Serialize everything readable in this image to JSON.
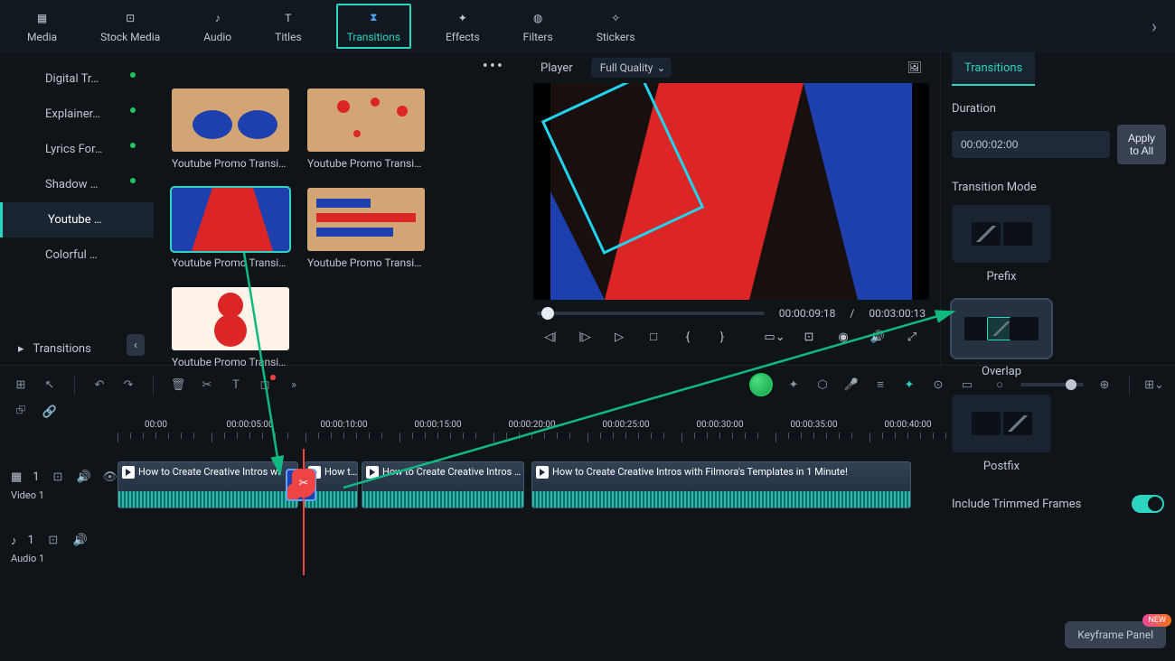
{
  "topTabs": {
    "media": "Media",
    "stockMedia": "Stock Media",
    "audio": "Audio",
    "titles": "Titles",
    "transitions": "Transitions",
    "effects": "Effects",
    "filters": "Filters",
    "stickers": "Stickers"
  },
  "sidebar": {
    "items": [
      {
        "label": "Digital Tr…"
      },
      {
        "label": "Explainer…"
      },
      {
        "label": "Lyrics For…"
      },
      {
        "label": "Shadow …"
      },
      {
        "label": "Youtube …"
      },
      {
        "label": "Colorful …"
      }
    ],
    "bottomGroup": "Transitions"
  },
  "library": {
    "items": [
      {
        "label": "Youtube Promo Transi…"
      },
      {
        "label": "Youtube Promo Transi…"
      },
      {
        "label": "Youtube Promo Transi…"
      },
      {
        "label": "Youtube Promo Transi…"
      },
      {
        "label": "Youtube Promo Transi…"
      }
    ],
    "selectedIndex": 2
  },
  "player": {
    "label": "Player",
    "quality": "Full Quality",
    "currentTime": "00:00:09:18",
    "divider": "/",
    "duration": "00:03:00:13"
  },
  "rightPanel": {
    "tab": "Transitions",
    "durationLabel": "Duration",
    "durationValue": "00:00:02:00",
    "applyAll": "Apply to All",
    "modeLabel": "Transition Mode",
    "modes": {
      "prefix": "Prefix",
      "overlap": "Overlap",
      "postfix": "Postfix"
    },
    "includeTrimmed": "Include Trimmed Frames"
  },
  "timeline": {
    "ruler": [
      "00:00",
      "00:00:05:00",
      "00:00:10:00",
      "00:00:15:00",
      "00:00:20:00",
      "00:00:25:00",
      "00:00:30:00",
      "00:00:35:00",
      "00:00:40:00"
    ],
    "track1": {
      "name": "Video 1",
      "count": "1"
    },
    "track2": {
      "name": "Audio 1",
      "count": "1"
    },
    "clip1": "How to Create Creative Intros wi",
    "clip2": "How t…",
    "clip3": "How to Create Creative Intros …",
    "clip4": "How to Create Creative Intros with Filmora's Templates in 1 Minute!"
  },
  "keyframePanel": {
    "label": "Keyframe Panel",
    "badge": "NEW"
  }
}
